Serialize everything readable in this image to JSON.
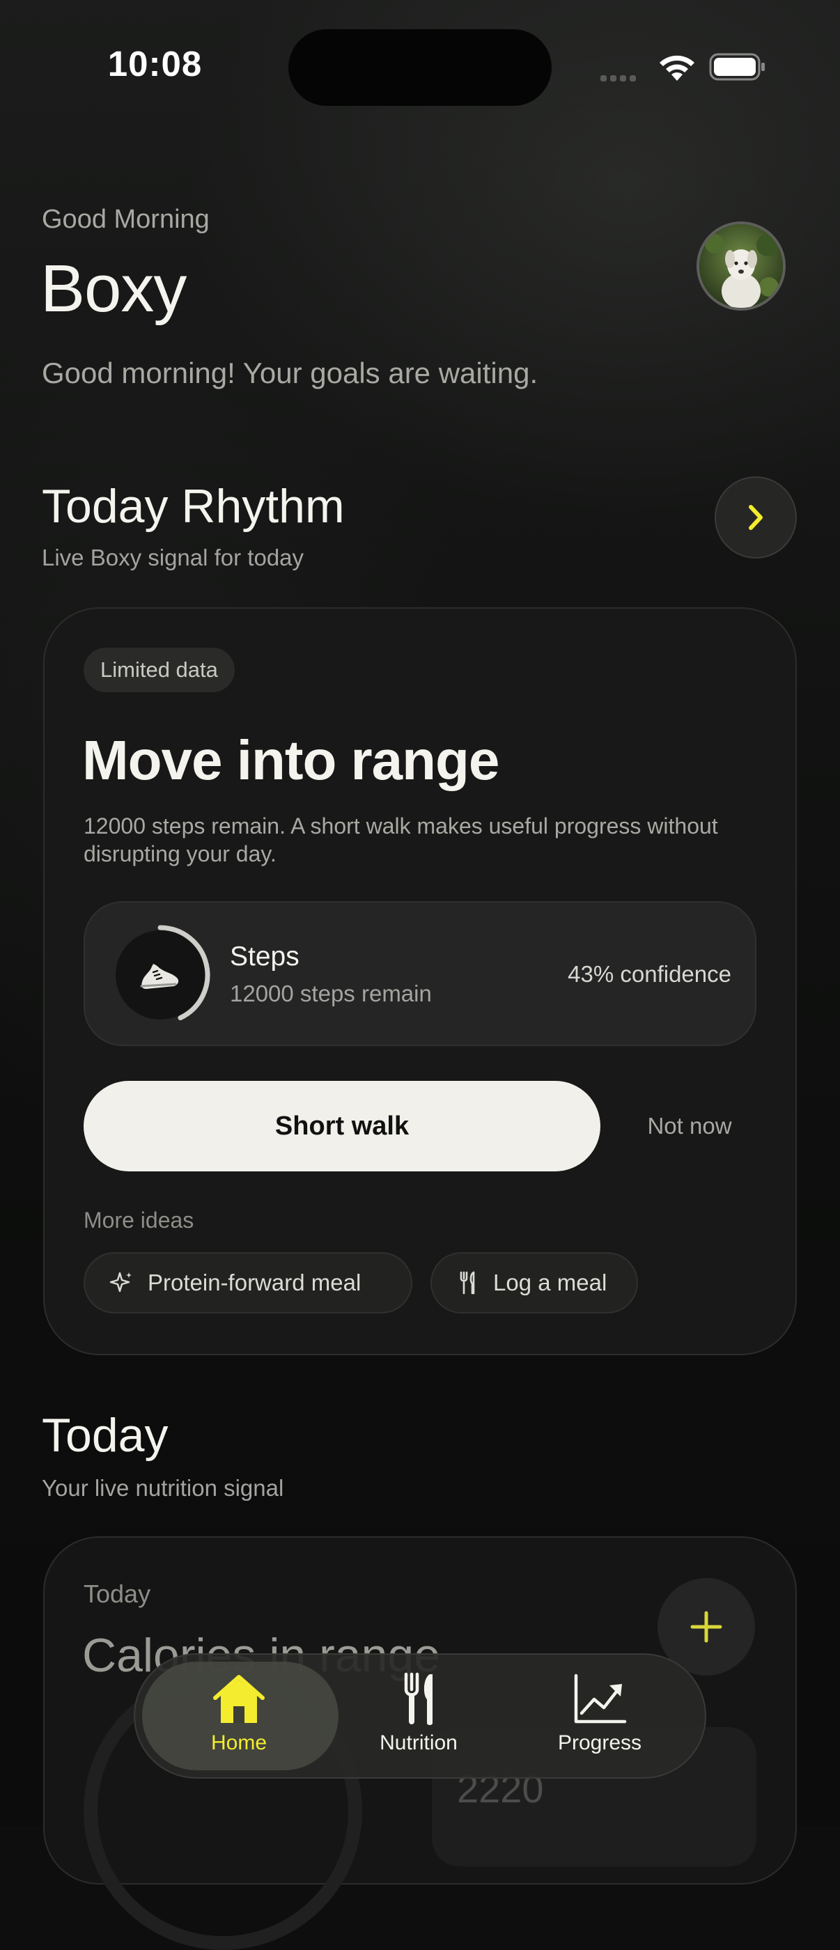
{
  "status_bar": {
    "time": "10:08"
  },
  "header": {
    "greeting": "Good Morning",
    "name": "Boxy",
    "subtitle": "Good morning! Your goals are waiting.",
    "avatar_icon": "dog-avatar"
  },
  "rhythm": {
    "title": "Today Rhythm",
    "subtitle": "Live Boxy signal for today",
    "open_icon": "chevron-right-icon",
    "card": {
      "tag": "Limited data",
      "title": "Move into range",
      "description": "12000 steps remain. A short walk makes useful progress without disrupting your day.",
      "metric": {
        "label": "Steps",
        "detail": "12000 steps remain",
        "confidence": "43% confidence",
        "icon": "shoe-icon",
        "progress_fraction": 0.43
      },
      "primary_action": "Short walk",
      "secondary_action": "Not now",
      "more_ideas_label": "More ideas",
      "ideas": [
        {
          "label": "Protein-forward meal",
          "icon": "sparkle-icon"
        },
        {
          "label": "Log a meal",
          "icon": "utensils-icon"
        }
      ]
    }
  },
  "today": {
    "title": "Today",
    "subtitle": "Your live nutrition signal",
    "card": {
      "label": "Today",
      "title": "Calories in range",
      "value": "2220",
      "add_icon": "plus-icon"
    }
  },
  "tabbar": {
    "tabs": [
      {
        "label": "Home",
        "icon": "home-icon",
        "active": true
      },
      {
        "label": "Nutrition",
        "icon": "fork-knife-icon",
        "active": false
      },
      {
        "label": "Progress",
        "icon": "trend-chart-icon",
        "active": false
      }
    ]
  },
  "colors": {
    "background": "#0d0e0d",
    "accent": "#f4ec2e",
    "primary_button": "#f1f0eb"
  }
}
